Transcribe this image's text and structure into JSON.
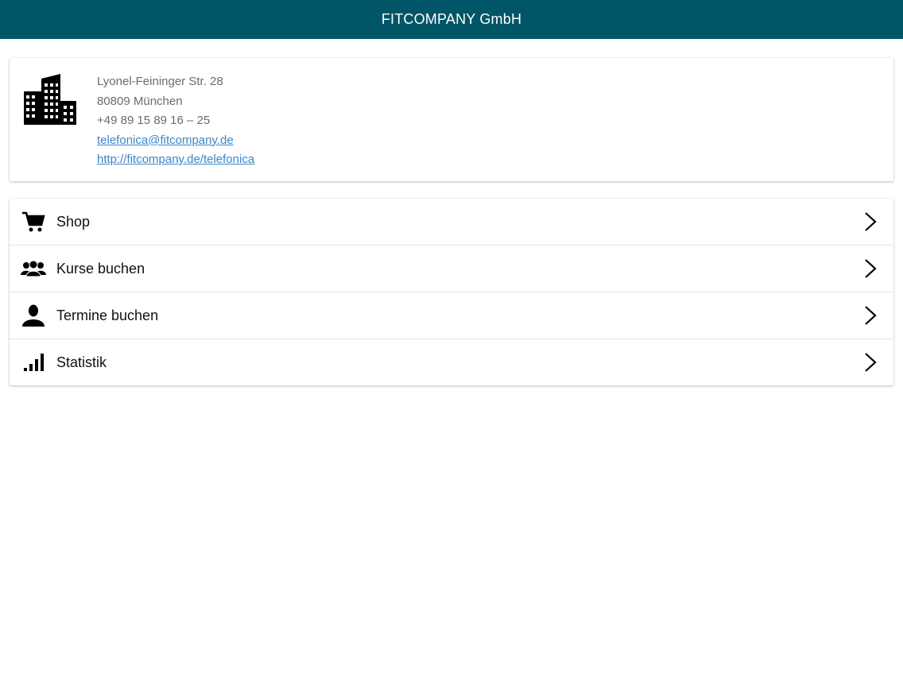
{
  "header": {
    "title": "FITCOMPANY GmbH"
  },
  "info": {
    "icon": "building-icon",
    "street": "Lyonel-Feininger Str. 28",
    "city": "80809 München",
    "phone": "+49 89 15 89 16 – 25",
    "email": "telefonica@fitcompany.de",
    "website": "http://fitcompany.de/telefonica",
    "link_color": "#3a86c8"
  },
  "menu": {
    "items": [
      {
        "label": "Shop",
        "icon": "cart-icon"
      },
      {
        "label": "Kurse buchen",
        "icon": "group-icon"
      },
      {
        "label": "Termine buchen",
        "icon": "person-icon"
      },
      {
        "label": "Statistik",
        "icon": "signal-bars-icon"
      }
    ]
  },
  "colors": {
    "header_bg": "#005566",
    "header_text": "#ffffff"
  }
}
